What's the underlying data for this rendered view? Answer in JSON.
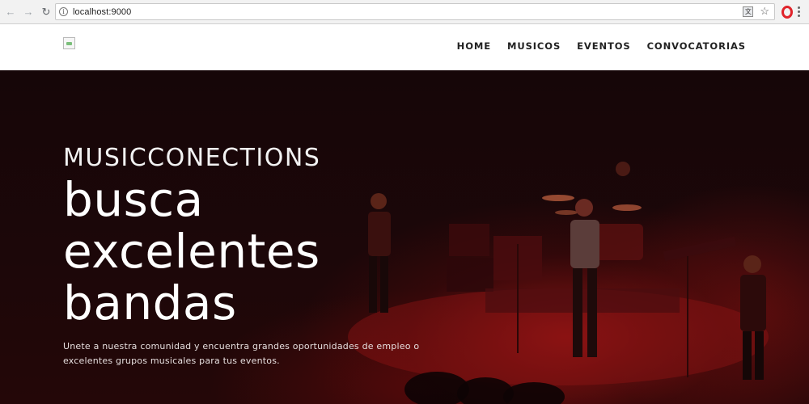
{
  "browser": {
    "url": "localhost:9000",
    "back_icon": "arrow-left",
    "forward_icon": "arrow-right",
    "reload_icon": "reload",
    "opera_icon": "opera-logo"
  },
  "header": {
    "logo_alt": "",
    "nav": [
      "HOME",
      "MUSICOS",
      "EVENTOS",
      "CONVOCATORIAS"
    ]
  },
  "hero": {
    "brand": "MUSICCONECTIONS",
    "headline_lines": [
      "busca",
      "excelentes",
      "bandas"
    ],
    "description": "Unete a nuestra comunidad y encuentra grandes oportunidades de empleo o excelentes grupos musicales para tus eventos."
  },
  "colors": {
    "hero_bg": "#1c0709",
    "stage_red": "#aa1616",
    "opera_red": "#e0242b"
  }
}
